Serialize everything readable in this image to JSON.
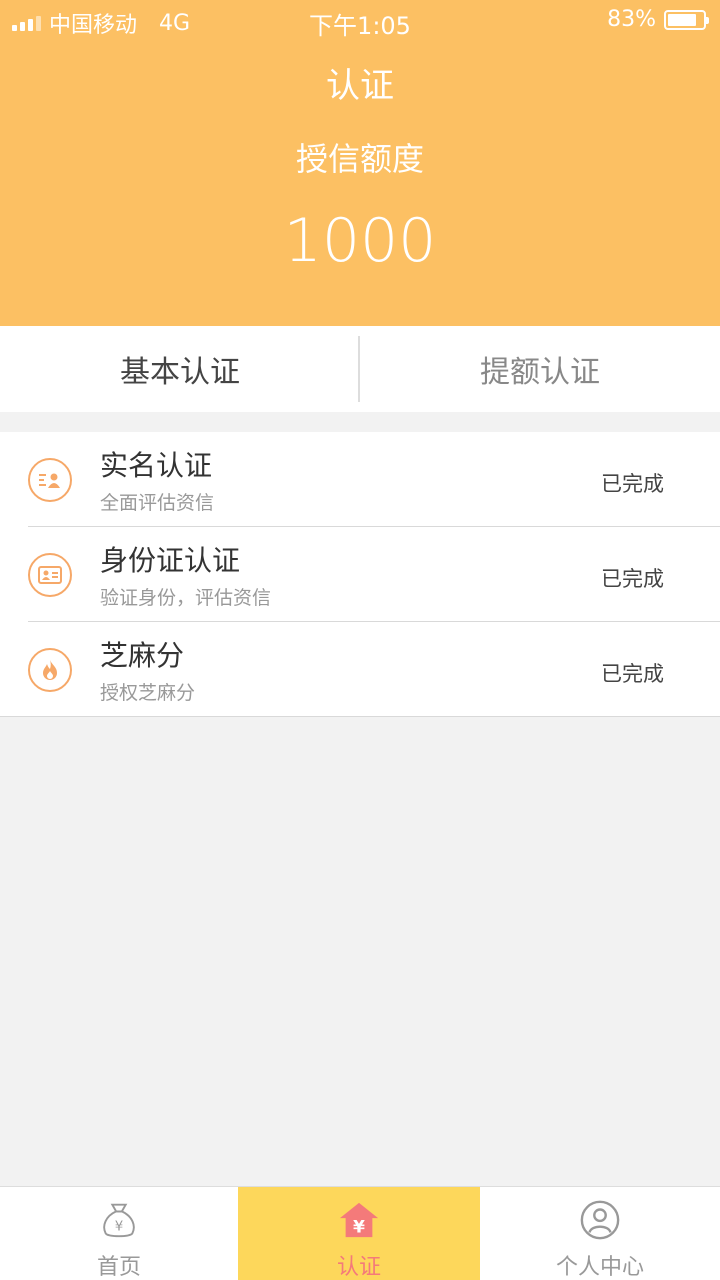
{
  "status_bar": {
    "carrier": "中国移动",
    "network": "4G",
    "time": "下午1:05",
    "battery_percent": "83%",
    "battery_level": 0.83
  },
  "header": {
    "title": "认证",
    "credit_label": "授信额度",
    "credit_amount": "1000",
    "background_color": "#fcc063"
  },
  "tabs": [
    {
      "label": "基本认证",
      "active": true
    },
    {
      "label": "提额认证",
      "active": false
    }
  ],
  "items": [
    {
      "title": "实名认证",
      "subtitle": "全面评估资信",
      "status": "已完成",
      "icon": "realname-id-icon"
    },
    {
      "title": "身份证认证",
      "subtitle": "验证身份，评估资信",
      "status": "已完成",
      "icon": "id-card-icon"
    },
    {
      "title": "芝麻分",
      "subtitle": "授权芝麻分",
      "status": "已完成",
      "icon": "flame-icon"
    }
  ],
  "bottom_nav": [
    {
      "label": "首页",
      "icon": "money-bag-icon",
      "active": false
    },
    {
      "label": "认证",
      "icon": "house-yen-icon",
      "active": true
    },
    {
      "label": "个人中心",
      "icon": "person-icon",
      "active": false
    }
  ],
  "colors": {
    "accent": "#f6a868",
    "nav_active_bg": "#fdd75b",
    "nav_active_text": "#f47a7a"
  }
}
